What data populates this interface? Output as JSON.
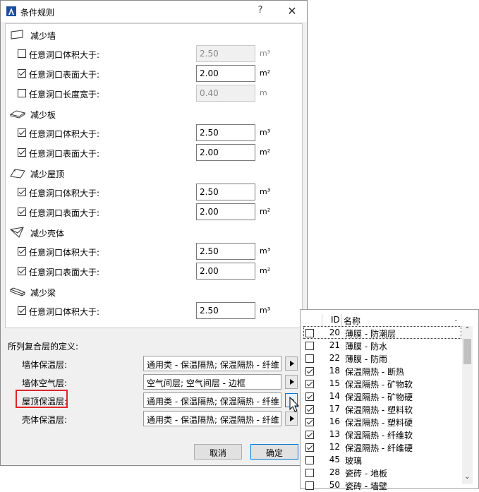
{
  "window": {
    "title": "条件规则",
    "help": "?",
    "close": "✕"
  },
  "sections": [
    {
      "title": "减少墙",
      "icon": "wall-icon",
      "rows": [
        {
          "label": "任意洞口体积大于:",
          "checked": false,
          "value": "2.50",
          "unit": "m³",
          "enabled": false
        },
        {
          "label": "任意洞口表面大于:",
          "checked": true,
          "value": "2.00",
          "unit": "m²",
          "enabled": true
        },
        {
          "label": "任意洞口长度宽于:",
          "checked": false,
          "value": "0.40",
          "unit": "m",
          "enabled": false
        }
      ]
    },
    {
      "title": "减少板",
      "icon": "slab-icon",
      "rows": [
        {
          "label": "任意洞口体积大于:",
          "checked": true,
          "value": "2.50",
          "unit": "m³",
          "enabled": true
        },
        {
          "label": "任意洞口表面大于:",
          "checked": true,
          "value": "2.00",
          "unit": "m²",
          "enabled": true
        }
      ]
    },
    {
      "title": "减少屋顶",
      "icon": "roof-icon",
      "rows": [
        {
          "label": "任意洞口体积大于:",
          "checked": true,
          "value": "2.50",
          "unit": "m³",
          "enabled": true
        },
        {
          "label": "任意洞口表面大于:",
          "checked": true,
          "value": "2.00",
          "unit": "m²",
          "enabled": true
        }
      ]
    },
    {
      "title": "减少壳体",
      "icon": "shell-icon",
      "rows": [
        {
          "label": "任意洞口体积大于:",
          "checked": true,
          "value": "2.50",
          "unit": "m³",
          "enabled": true
        },
        {
          "label": "任意洞口表面大于:",
          "checked": true,
          "value": "2.00",
          "unit": "m²",
          "enabled": true
        }
      ]
    },
    {
      "title": "减少梁",
      "icon": "beam-icon",
      "rows": [
        {
          "label": "任意洞口体积大于:",
          "checked": true,
          "value": "2.50",
          "unit": "m³",
          "enabled": true
        }
      ]
    }
  ],
  "composite": {
    "title": "所列复合层的定义:",
    "rows": [
      {
        "label": "墙体保温层:",
        "value": "通用类 - 保温隔热; 保温隔热 - 纤维"
      },
      {
        "label": "墙体空气层:",
        "value": "空气间层; 空气间层 - 边框"
      },
      {
        "label": "屋顶保温层:",
        "value": "通用类 - 保温隔热; 保温隔热 - 纤维"
      },
      {
        "label": "壳体保温层:",
        "value": "通用类 - 保温隔热; 保温隔热 - 纤维"
      }
    ]
  },
  "buttons": {
    "cancel": "取消",
    "ok": "确定"
  },
  "popup": {
    "header": {
      "id": "ID",
      "name": "名称"
    },
    "items": [
      {
        "checked": false,
        "id": "20",
        "name": "薄膜 - 防潮层"
      },
      {
        "checked": false,
        "id": "21",
        "name": "薄膜 - 防水"
      },
      {
        "checked": false,
        "id": "22",
        "name": "薄膜 - 防雨"
      },
      {
        "checked": true,
        "id": "18",
        "name": "保温隔热 - 断热"
      },
      {
        "checked": true,
        "id": "15",
        "name": "保温隔热 - 矿物软"
      },
      {
        "checked": true,
        "id": "14",
        "name": "保温隔热 - 矿物硬"
      },
      {
        "checked": true,
        "id": "17",
        "name": "保温隔热 - 塑料软"
      },
      {
        "checked": true,
        "id": "16",
        "name": "保温隔热 - 塑料硬"
      },
      {
        "checked": true,
        "id": "13",
        "name": "保温隔热 - 纤维软"
      },
      {
        "checked": true,
        "id": "12",
        "name": "保温隔热 - 纤维硬"
      },
      {
        "checked": false,
        "id": "45",
        "name": "玻璃"
      },
      {
        "checked": false,
        "id": "28",
        "name": "瓷砖 - 地板"
      },
      {
        "checked": false,
        "id": "50",
        "name": "瓷砖 - 墙壁"
      }
    ]
  }
}
